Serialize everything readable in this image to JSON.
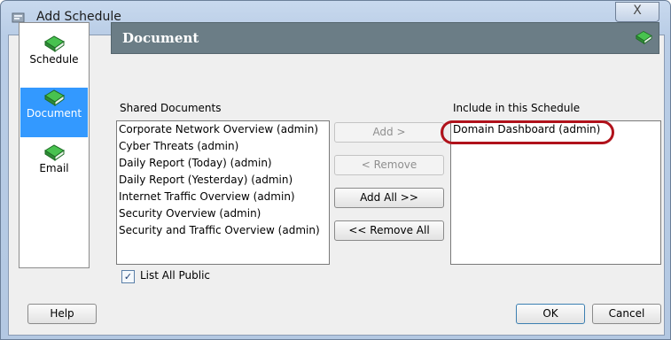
{
  "window": {
    "title": "Add Schedule",
    "close_glyph": "X"
  },
  "sidebar": {
    "items": [
      {
        "label": "Schedule",
        "icon": "book-icon",
        "selected": false
      },
      {
        "label": "Document",
        "icon": "book-icon",
        "selected": true
      },
      {
        "label": "Email",
        "icon": "book-icon",
        "selected": false
      }
    ]
  },
  "panel": {
    "title": "Document",
    "icon": "book-icon"
  },
  "shared": {
    "label": "Shared Documents",
    "items": [
      "Corporate Network Overview (admin)",
      "Cyber Threats (admin)",
      "Daily Report (Today) (admin)",
      "Daily Report (Yesterday) (admin)",
      "Internet Traffic Overview (admin)",
      "Security Overview (admin)",
      "Security and Traffic Overview (admin)"
    ]
  },
  "buttons": {
    "add": "Add >",
    "remove": "< Remove",
    "add_all": "Add All >>",
    "remove_all": "<< Remove All",
    "help": "Help",
    "ok": "OK",
    "cancel": "Cancel"
  },
  "included": {
    "label": "Include in this Schedule",
    "items": [
      "Domain Dashboard (admin)"
    ]
  },
  "list_all_public": {
    "label": "List All Public",
    "checked": true,
    "glyph": "✓"
  },
  "colors": {
    "accent_selection": "#3399ff",
    "header": "#6b7d86",
    "annotation_ring": "#b0121b",
    "book_green": "#2e9b3a"
  }
}
